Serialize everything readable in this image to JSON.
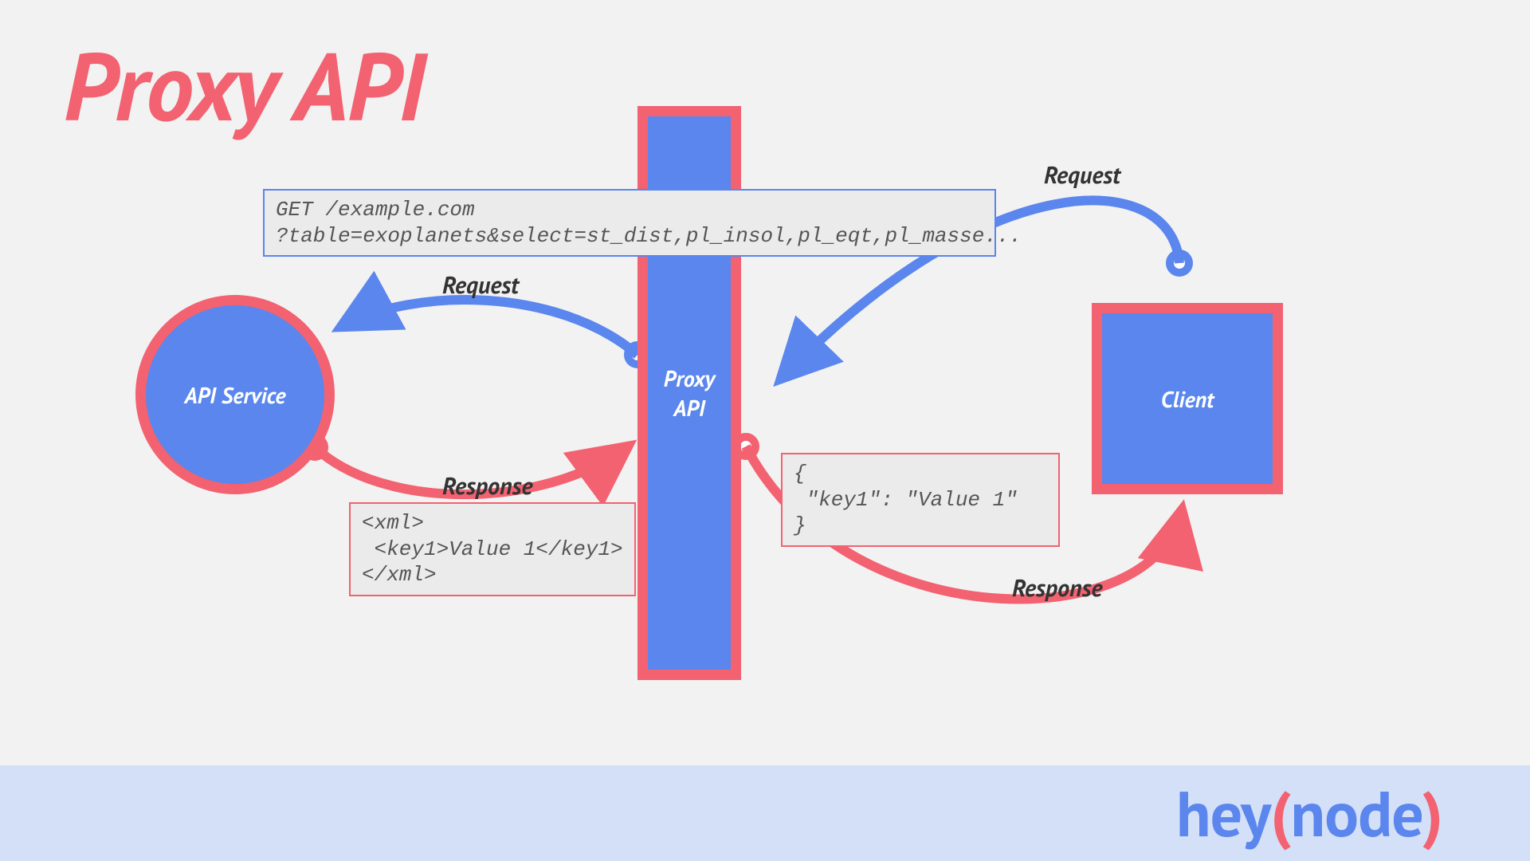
{
  "title": "Proxy API",
  "nodes": {
    "api_service": "API Service",
    "proxy_api": "Proxy\nAPI",
    "client": "Client"
  },
  "labels": {
    "request_client_to_proxy": "Request",
    "request_proxy_to_api": "Request",
    "response_api_to_proxy": "Response",
    "response_proxy_to_client": "Response"
  },
  "codeboxes": {
    "http_request": "GET /example.com\n?table=exoplanets&select=st_dist,pl_insol,pl_eqt,pl_masse...",
    "xml_response": "<xml>\n <key1>Value 1</key1>\n</xml>",
    "json_response": "{\n \"key1\": \"Value 1\"\n}"
  },
  "footer": {
    "logo_hey": "hey",
    "logo_lparen": "(",
    "logo_node": "node",
    "logo_rparen": ")"
  },
  "colors": {
    "red": "#f26271",
    "blue": "#5a86ed",
    "bg": "#f2f2f2",
    "footer_bg": "#d3e0f7"
  }
}
